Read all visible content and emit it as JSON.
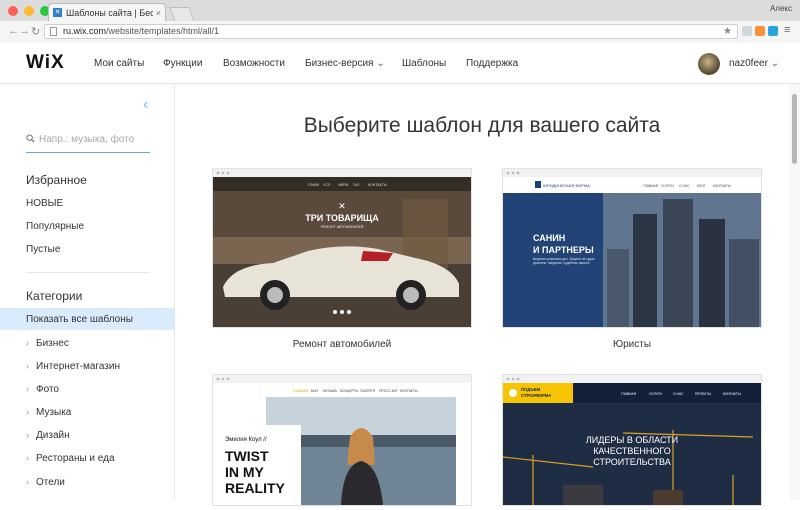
{
  "browser": {
    "tab_title": "Шаблоны сайта | Бесплатны",
    "profile_name": "Алекс",
    "url_host": "ru.wix.com",
    "url_path": "/website/templates/html/all/1"
  },
  "header": {
    "logo": "WiX",
    "nav": [
      "Мои сайты",
      "Функции",
      "Возможности",
      "Бизнес-версия",
      "Шаблоны",
      "Поддержка"
    ],
    "username": "naz0feer"
  },
  "sidebar": {
    "search_placeholder": "Напр.: музыка, фото",
    "favorites_title": "Избранное",
    "favorites": [
      "НОВЫЕ",
      "Популярные",
      "Пустые"
    ],
    "categories_title": "Категории",
    "show_all": "Показать все шаблоны",
    "categories": [
      "Бизнес",
      "Интернет-магазин",
      "Фото",
      "Музыка",
      "Дизайн",
      "Рестораны и еда",
      "Отели"
    ]
  },
  "main": {
    "title": "Выберите шаблон для вашего сайта",
    "templates": [
      {
        "label": "Ремонт автомобилей",
        "hero": "ТРИ ТОВАРИЩА",
        "sub": "РЕМОНТ АВТОМОБИЛЕЙ",
        "menu": [
          "ГЛАВН",
          "УСЛ",
          "ФИРМ",
          "ГАЛ",
          "КОНТАКТЫ"
        ]
      },
      {
        "label": "Юристы",
        "brand": "ЮРИДИЧЕСКАЯ ФИРМА",
        "hero1": "САНИН",
        "hero2": "И ПАРТНЕРЫ",
        "sub": "Ведение успешных дел. Защита на судах дешевле, сведения, судебная защита.",
        "menu": [
          "ГЛАВНАЯ",
          "УСЛУГИ",
          "О НАС",
          "БЛОГ",
          "КОНТАКТЫ"
        ]
      },
      {
        "label": "",
        "name": "Эмилия Коул //",
        "hero1": "TWIST",
        "hero2": "IN MY",
        "hero3": "REALITY",
        "menu": [
          "ГЛАВНАЯ",
          "БИО",
          "МУЗЫКА",
          "КОНЦЕРТЫ",
          "ГАЛЕРЕЯ",
          "ПРЕСС-КИТ",
          "КОНТАКТЫ"
        ]
      },
      {
        "label": "",
        "brand1": "ПОДЪЕМ",
        "brand2": "СТРОИФИРМА",
        "hero1": "ЛИДЕРЫ В ОБЛАСТИ",
        "hero2": "КАЧЕСТВЕННОГО",
        "hero3": "СТРОИТЕЛЬСТВА",
        "menu": [
          "ГЛАВНАЯ",
          "УСЛУГИ",
          "О НАС",
          "ПРОЕКТЫ",
          "КОНТАКТЫ"
        ]
      }
    ]
  },
  "colors": {
    "accent": "#6ea8d8",
    "active_bg": "#d8ecfb",
    "close": "#fc5f57",
    "minimize": "#fdbc2e",
    "maximize": "#28c840",
    "lawyer_nav": "#1d3f73",
    "construction_yellow": "#f6c400"
  }
}
